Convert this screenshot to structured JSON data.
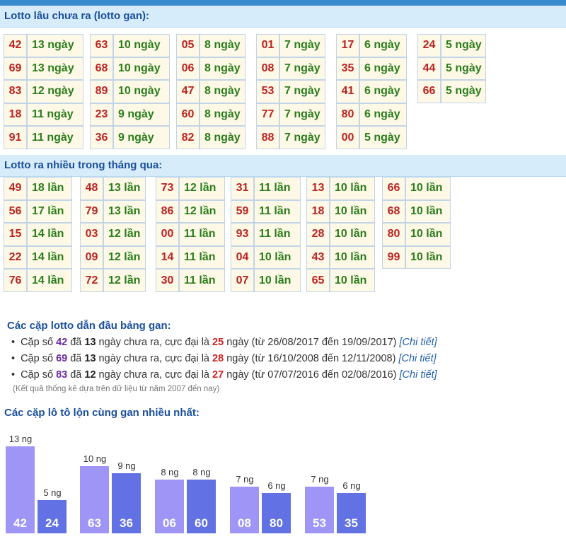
{
  "gan": {
    "title": "Lotto lâu chưa ra (lotto gan):",
    "columns": [
      [
        [
          "42",
          "13 ngày"
        ],
        [
          "69",
          "13 ngày"
        ],
        [
          "83",
          "12 ngày"
        ],
        [
          "18",
          "11 ngày"
        ],
        [
          "91",
          "11 ngày"
        ]
      ],
      [
        [
          "63",
          "10 ngày"
        ],
        [
          "68",
          "10 ngày"
        ],
        [
          "89",
          "10 ngày"
        ],
        [
          "23",
          "9 ngày"
        ],
        [
          "36",
          "9 ngày"
        ]
      ],
      [
        [
          "05",
          "8 ngày"
        ],
        [
          "06",
          "8 ngày"
        ],
        [
          "47",
          "8 ngày"
        ],
        [
          "60",
          "8 ngày"
        ],
        [
          "82",
          "8 ngày"
        ]
      ],
      [
        [
          "01",
          "7 ngày"
        ],
        [
          "08",
          "7 ngày"
        ],
        [
          "53",
          "7 ngày"
        ],
        [
          "77",
          "7 ngày"
        ],
        [
          "88",
          "7 ngày"
        ]
      ],
      [
        [
          "17",
          "6 ngày"
        ],
        [
          "35",
          "6 ngày"
        ],
        [
          "41",
          "6 ngày"
        ],
        [
          "80",
          "6 ngày"
        ],
        [
          "00",
          "5 ngày"
        ]
      ],
      [
        [
          "24",
          "5 ngày"
        ],
        [
          "44",
          "5 ngày"
        ],
        [
          "66",
          "5 ngày"
        ]
      ]
    ]
  },
  "frequent": {
    "title": "Lotto ra nhiều trong tháng qua:",
    "columns": [
      [
        [
          "49",
          "18 lần"
        ],
        [
          "56",
          "17 lần"
        ],
        [
          "15",
          "14 lần"
        ],
        [
          "22",
          "14 lần"
        ],
        [
          "76",
          "14 lần"
        ]
      ],
      [
        [
          "48",
          "13 lần"
        ],
        [
          "79",
          "13 lần"
        ],
        [
          "03",
          "12 lần"
        ],
        [
          "09",
          "12 lần"
        ],
        [
          "72",
          "12 lần"
        ]
      ],
      [
        [
          "73",
          "12 lần"
        ],
        [
          "86",
          "12 lần"
        ],
        [
          "00",
          "11 lần"
        ],
        [
          "14",
          "11 lần"
        ],
        [
          "30",
          "11 lần"
        ]
      ],
      [
        [
          "31",
          "11 lần"
        ],
        [
          "59",
          "11 lần"
        ],
        [
          "93",
          "11 lần"
        ],
        [
          "04",
          "10 lần"
        ],
        [
          "07",
          "10 lần"
        ]
      ],
      [
        [
          "13",
          "10 lần"
        ],
        [
          "18",
          "10 lần"
        ],
        [
          "28",
          "10 lần"
        ],
        [
          "43",
          "10 lần"
        ],
        [
          "65",
          "10 lần"
        ]
      ],
      [
        [
          "66",
          "10 lần"
        ],
        [
          "68",
          "10 lần"
        ],
        [
          "80",
          "10 lần"
        ],
        [
          "99",
          "10 lần"
        ]
      ]
    ]
  },
  "pairs": {
    "title": "Các cặp lotto dẫn đầu bảng gan:",
    "items": [
      {
        "pre": "Cặp số ",
        "num": "42",
        "mid1": " đã ",
        "days": "13",
        "mid2": " ngày chưa ra, cực đại là ",
        "max": "25",
        "post": " ngày (từ 26/08/2017 đến 19/09/2017) ",
        "link": "[Chi tiết]"
      },
      {
        "pre": "Cặp số ",
        "num": "69",
        "mid1": " đã ",
        "days": "13",
        "mid2": " ngày chưa ra, cực đại là ",
        "max": "28",
        "post": " ngày (từ 16/10/2008 đến 12/11/2008) ",
        "link": "[Chi tiết]"
      },
      {
        "pre": "Cặp số ",
        "num": "83",
        "mid1": " đã ",
        "days": "12",
        "mid2": " ngày chưa ra, cực đại là ",
        "max": "27",
        "post": " ngày (từ 07/07/2016 đến 02/08/2016) ",
        "link": "[Chi tiết]"
      }
    ],
    "note": "(Kết quả thống kê dựa trên dữ liệu từ năm 2007 đến nay)"
  },
  "bars": {
    "title": "Các cặp lô tô lộn cùng gan nhiều nhất:",
    "groups": [
      [
        {
          "code": "42",
          "days": 13,
          "label": "13 ng"
        },
        {
          "code": "24",
          "days": 5,
          "label": "5 ng"
        }
      ],
      [
        {
          "code": "63",
          "days": 10,
          "label": "10 ng"
        },
        {
          "code": "36",
          "days": 9,
          "label": "9 ng"
        }
      ],
      [
        {
          "code": "06",
          "days": 8,
          "label": "8 ng"
        },
        {
          "code": "60",
          "days": 8,
          "label": "8 ng"
        }
      ],
      [
        {
          "code": "08",
          "days": 7,
          "label": "7 ng"
        },
        {
          "code": "80",
          "days": 6,
          "label": "6 ng"
        }
      ],
      [
        {
          "code": "53",
          "days": 7,
          "label": "7 ng"
        },
        {
          "code": "35",
          "days": 6,
          "label": "6 ng"
        }
      ]
    ]
  },
  "colors": {
    "header_bg": "#d7ecfb",
    "header_text": "#1a4f9c",
    "num": "#b22222",
    "count": "#2a7d1c",
    "bar_light": "#9e95f7",
    "bar_dark": "#6271e3"
  }
}
